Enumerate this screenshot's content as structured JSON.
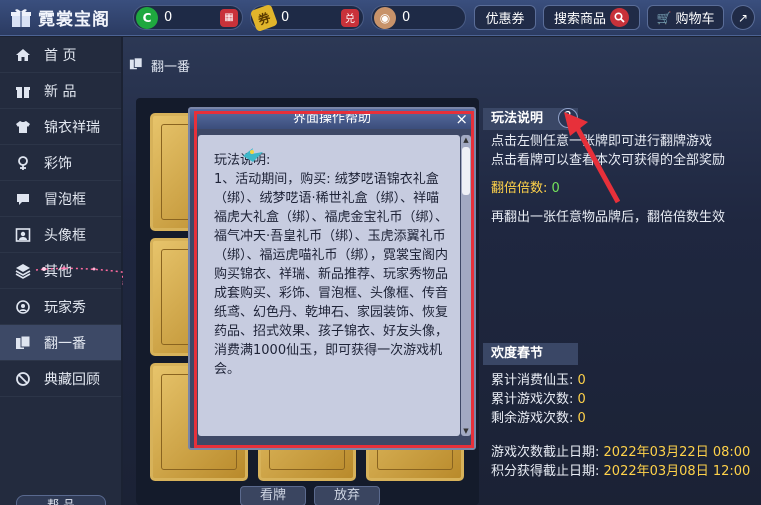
{
  "app": {
    "title": "霓裳宝阁"
  },
  "currencies": [
    {
      "name": "green-coin",
      "value": "0",
      "color": "#1fa83f",
      "button": ""
    },
    {
      "name": "yellow-ticket",
      "value": "0",
      "color": "#e1b52b",
      "button": "兑"
    },
    {
      "name": "bronze-coin",
      "value": "0",
      "color": "#c8936a",
      "button": ""
    }
  ],
  "topbar": {
    "coupon": "优惠券",
    "search": "搜索商品",
    "cart": "购物车"
  },
  "sidebar": {
    "items": [
      {
        "label": "首 页",
        "icon": "home-icon"
      },
      {
        "label": "新 品",
        "icon": "gift-icon"
      },
      {
        "label": "锦衣祥瑞",
        "icon": "shirt-icon"
      },
      {
        "label": "彩饰",
        "icon": "ornament-icon"
      },
      {
        "label": "冒泡框",
        "icon": "bubble-icon"
      },
      {
        "label": "头像框",
        "icon": "portrait-icon"
      },
      {
        "label": "其他",
        "icon": "layers-icon"
      },
      {
        "label": "玩家秀",
        "icon": "player-icon"
      },
      {
        "label": "翻一番",
        "icon": "cards-icon"
      },
      {
        "label": "典藏回顾",
        "icon": "ban-icon"
      }
    ],
    "active_index": 8,
    "bottom_label": "帮 品"
  },
  "breadcrumb": {
    "label": "翻一番"
  },
  "board": {
    "look_button": "看牌",
    "give_up_button": "放弃"
  },
  "rules": {
    "title": "玩法说明",
    "help": "?",
    "line1": "点击左侧任意一张牌即可进行翻牌游戏",
    "line2": "点击看牌可以查看本次可获得的全部奖励",
    "multiplier_label": "翻倍倍数:",
    "multiplier_value": "0",
    "line3": "再翻出一张任意物品牌后，翻倍倍数生效"
  },
  "event": {
    "title": "欢度春节",
    "spent_label": "累计消费仙玉:",
    "spent_value": "0",
    "games_label": "累计游戏次数:",
    "games_value": "0",
    "remaining_label": "剩余游戏次数:",
    "remaining_value": "0",
    "game_deadline_label": "游戏次数截止日期:",
    "game_deadline_value": "2022年03月22日 08:00",
    "points_deadline_label": "积分获得截止日期:",
    "points_deadline_value": "2022年03月08日 12:00"
  },
  "dialog": {
    "title": "界面操作帮助",
    "close": "×",
    "body": "玩法说明:\n1、活动期间，购买: 绒梦呓语锦衣礼盒（绑）、绒梦呓语·稀世礼盒（绑）、祥喵福虎大礼盒（绑）、福虎金宝礼币（绑）、福气冲天·吾皇礼币（绑）、玉虎添翼礼币（绑）、福运虎喵礼币（绑），霓裳宝阁内购买锦衣、祥瑞、新品推荐、玩家秀物品成套购买、彩饰、冒泡框、头像框、传音纸鸢、幻色丹、乾坤石、家园装饰、恢复药品、招式效果、孩子锦衣、好友头像，消费满1000仙玉，即可获得一次游戏机会。"
  },
  "colors": {
    "accent_red": "#e7303a",
    "highlight_green": "#74e25c",
    "highlight_yellow": "#ffd24a"
  }
}
